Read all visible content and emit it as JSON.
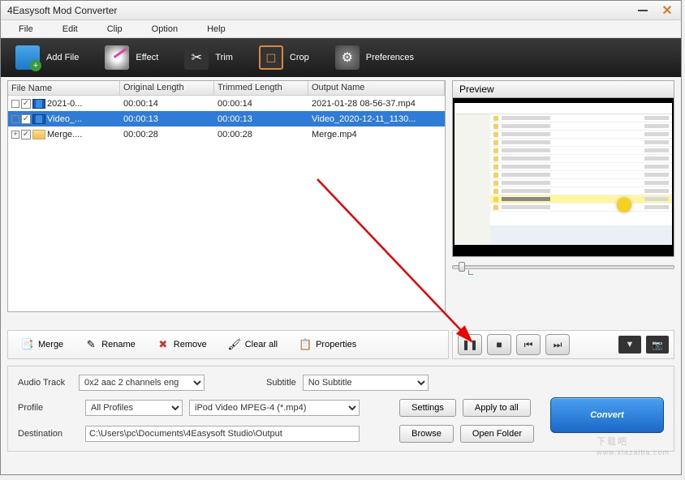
{
  "window": {
    "title": "4Easysoft Mod Converter"
  },
  "menu": {
    "file": "File",
    "edit": "Edit",
    "clip": "Clip",
    "option": "Option",
    "help": "Help"
  },
  "toolbar": {
    "addfile": "Add File",
    "effect": "Effect",
    "trim": "Trim",
    "crop": "Crop",
    "preferences": "Preferences"
  },
  "columns": {
    "filename": "File Name",
    "origlen": "Original Length",
    "trimlen": "Trimmed Length",
    "outname": "Output Name"
  },
  "rows": [
    {
      "name": "2021-0...",
      "orig": "00:00:14",
      "trim": "00:00:14",
      "out": "2021-01-28 08-56-37.mp4",
      "checked": true,
      "icon": "film",
      "expander": ""
    },
    {
      "name": "Video_...",
      "orig": "00:00:13",
      "trim": "00:00:13",
      "out": "Video_2020-12-11_1130...",
      "checked": true,
      "icon": "film",
      "selected": true,
      "expander": ""
    },
    {
      "name": "Merge....",
      "orig": "00:00:28",
      "trim": "00:00:28",
      "out": "Merge.mp4",
      "checked": true,
      "icon": "folder",
      "expander": "+"
    }
  ],
  "preview": {
    "label": "Preview"
  },
  "actions": {
    "merge": "Merge",
    "rename": "Rename",
    "remove": "Remove",
    "clearall": "Clear all",
    "properties": "Properties"
  },
  "bottom": {
    "audiotrack_label": "Audio Track",
    "audiotrack_value": "0x2 aac 2 channels eng",
    "subtitle_label": "Subtitle",
    "subtitle_value": "No Subtitle",
    "profile_label": "Profile",
    "profile_cat": "All Profiles",
    "profile_fmt": "iPod Video MPEG-4 (*.mp4)",
    "settings": "Settings",
    "applyall": "Apply to all",
    "destination_label": "Destination",
    "destination_value": "C:\\Users\\pc\\Documents\\4Easysoft Studio\\Output",
    "browse": "Browse",
    "openfolder": "Open Folder",
    "convert": "Convert"
  },
  "watermark": {
    "text": "下载吧",
    "url": "www.xiazaiba.com"
  }
}
